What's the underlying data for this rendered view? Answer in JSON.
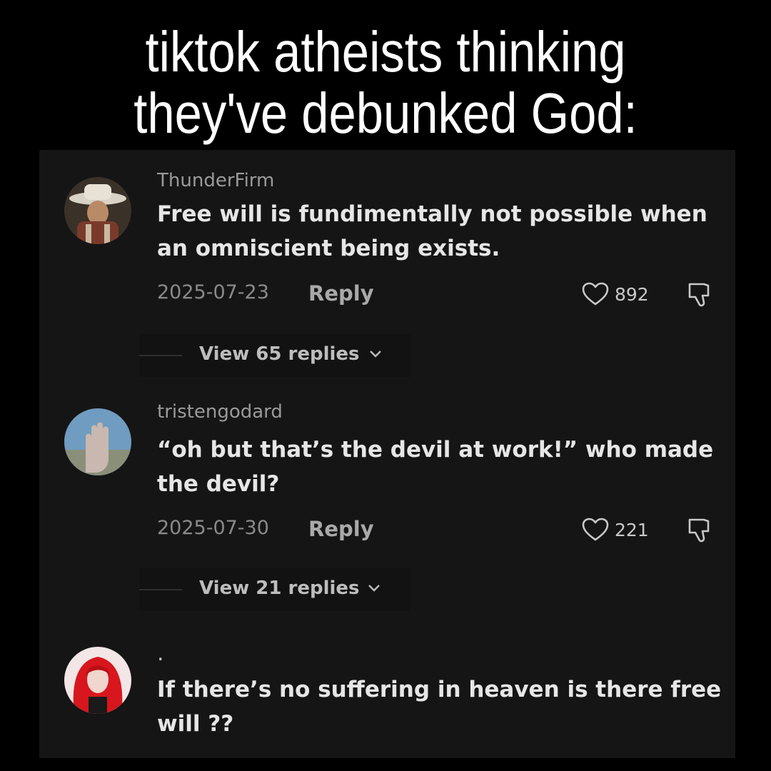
{
  "caption": {
    "line1": "tiktok atheists thinking",
    "line2": "they've debunked God:"
  },
  "comments": [
    {
      "username": "ThunderFirm",
      "text": "Free will is fundimentally not possible when an omniscient being exists.",
      "date": "2025-07-23",
      "reply_label": "Reply",
      "likes": "892",
      "view_replies": "View 65 replies",
      "avatar_icon": "cowboy-hat-avatar"
    },
    {
      "username": "tristengodard",
      "text": "“oh but that’s the devil at work!” who made the devil?",
      "date": "2025-07-30",
      "reply_label": "Reply",
      "likes": "221",
      "view_replies": "View 21 replies",
      "avatar_icon": "hand-avatar"
    },
    {
      "username": ".",
      "text": "If there’s no suffering in heaven is there free will ??",
      "avatar_icon": "red-hair-avatar"
    }
  ],
  "colors": {
    "page_background": "#000000",
    "panel_background": "#151515",
    "comment_text": "#e6e6e6",
    "muted_text": "#8a8a8a"
  }
}
